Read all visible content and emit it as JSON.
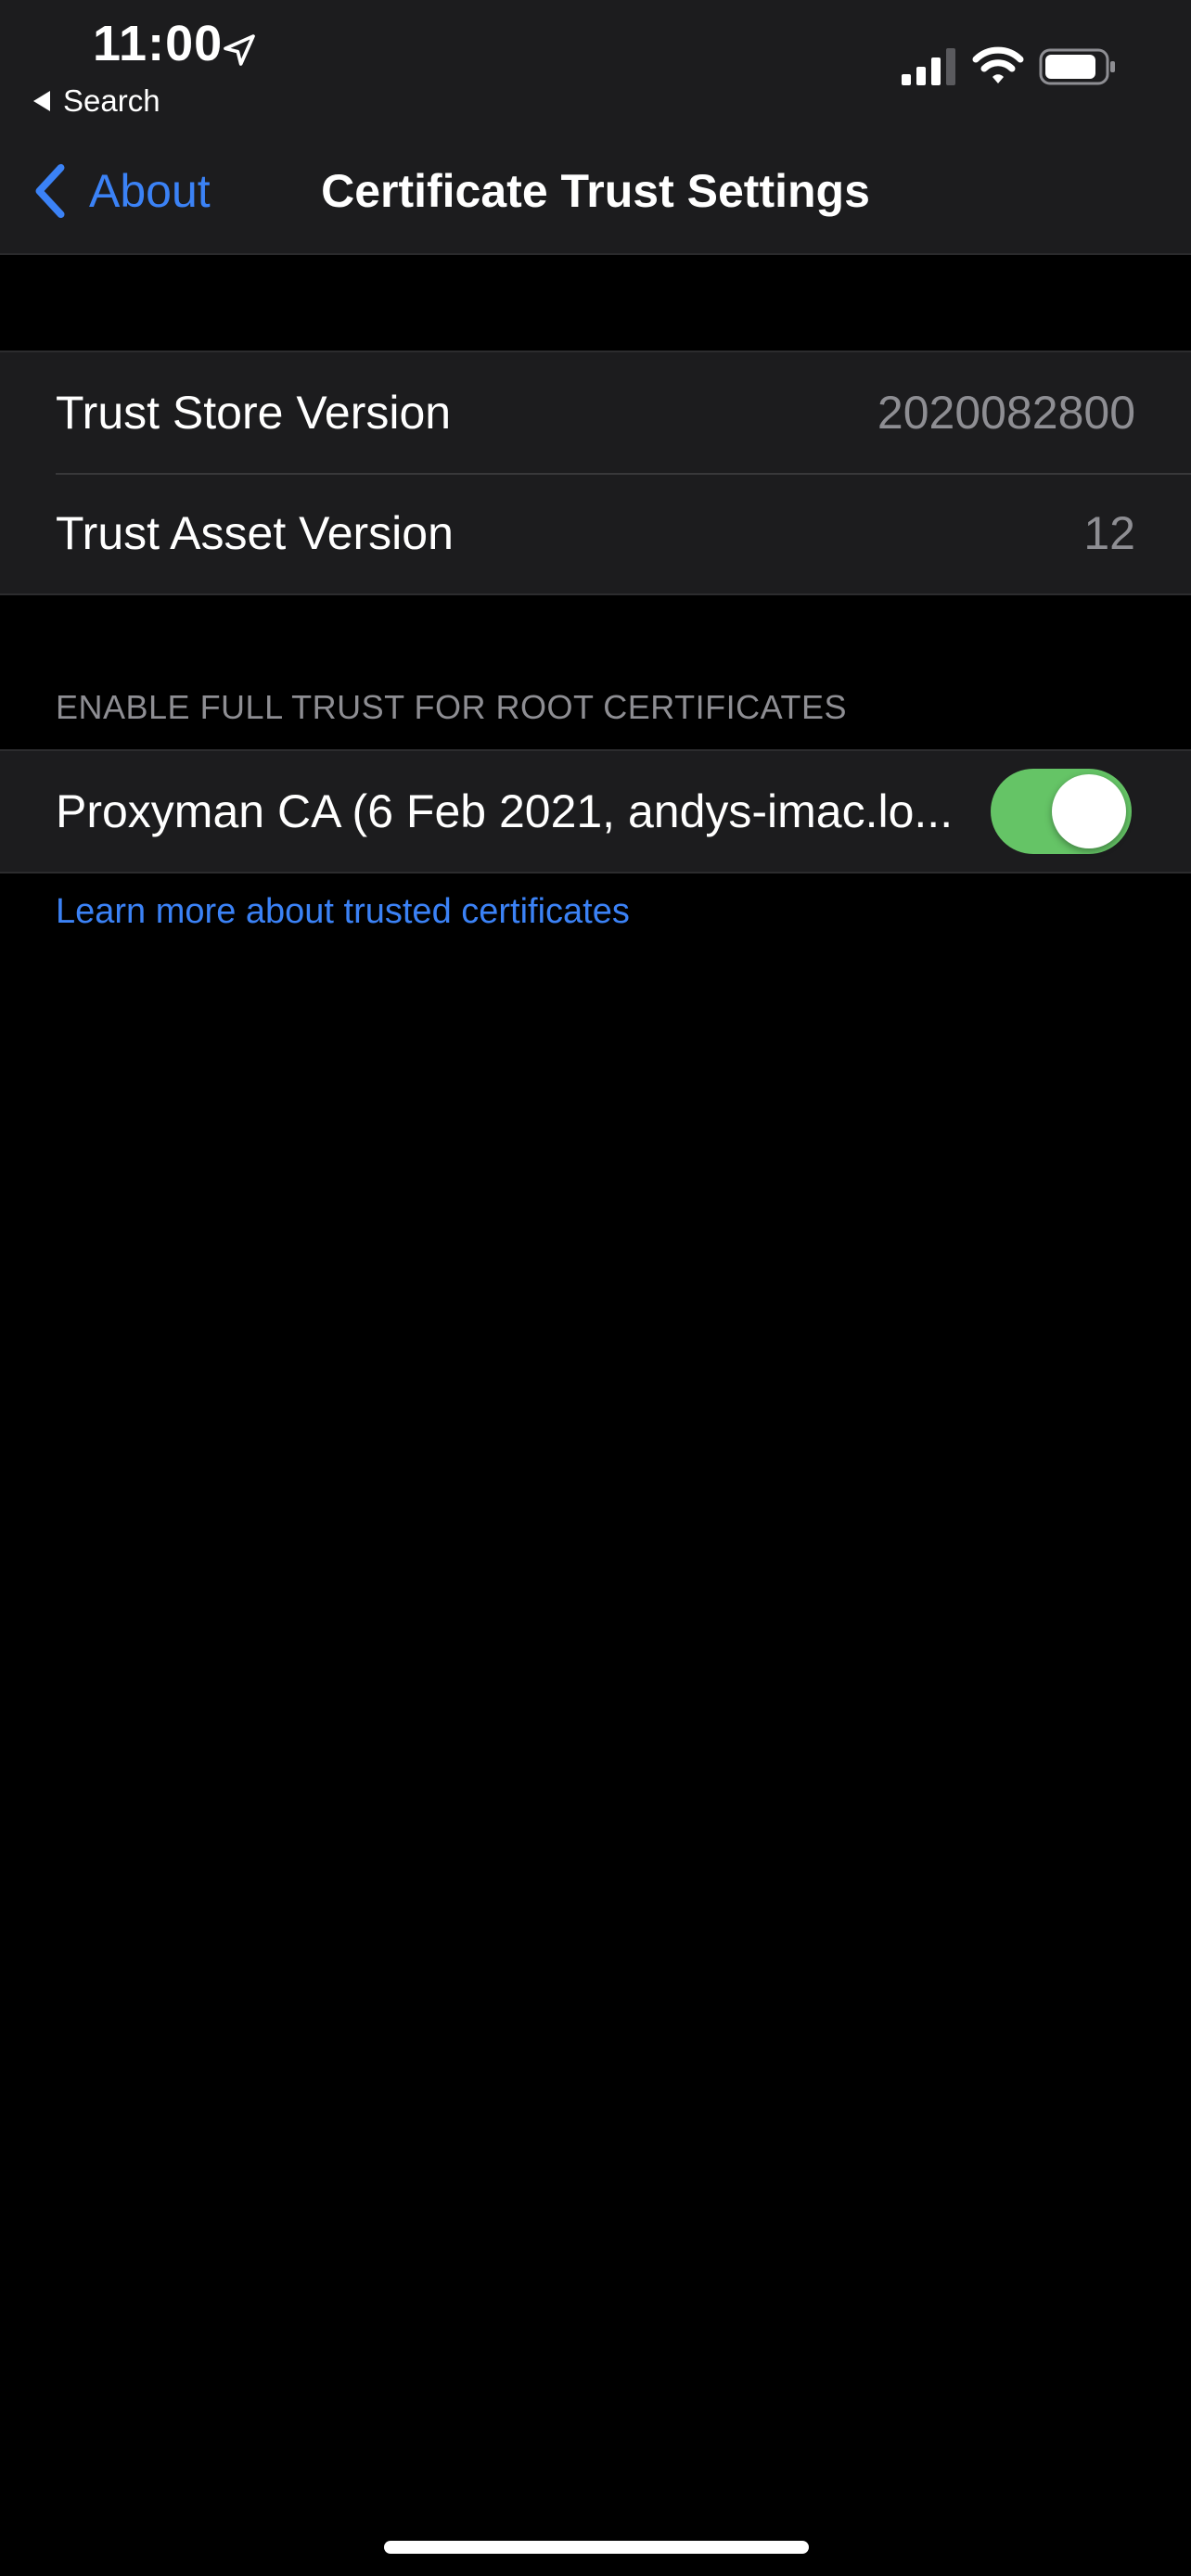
{
  "status_bar": {
    "time": "11:00",
    "back_app_label": "Search",
    "location_icon": "location-arrow-icon",
    "signal_icon": "cellular-signal-icon",
    "wifi_icon": "wifi-icon",
    "battery_icon": "battery-icon"
  },
  "nav": {
    "back_label": "About",
    "title": "Certificate Trust Settings"
  },
  "versions": [
    {
      "label": "Trust Store Version",
      "value": "2020082800"
    },
    {
      "label": "Trust Asset Version",
      "value": "12"
    }
  ],
  "full_trust": {
    "header": "ENABLE FULL TRUST FOR ROOT CERTIFICATES",
    "certificates": [
      {
        "label": "Proxyman CA (6 Feb 2021, andys-imac.lo...",
        "enabled": true
      }
    ]
  },
  "footer": {
    "learn_more": "Learn more about trusted certificates"
  },
  "colors": {
    "accent": "#3b82f6",
    "toggle_on": "#65c466",
    "group_bg": "#1c1c1e",
    "secondary_text": "#8e8e93"
  }
}
